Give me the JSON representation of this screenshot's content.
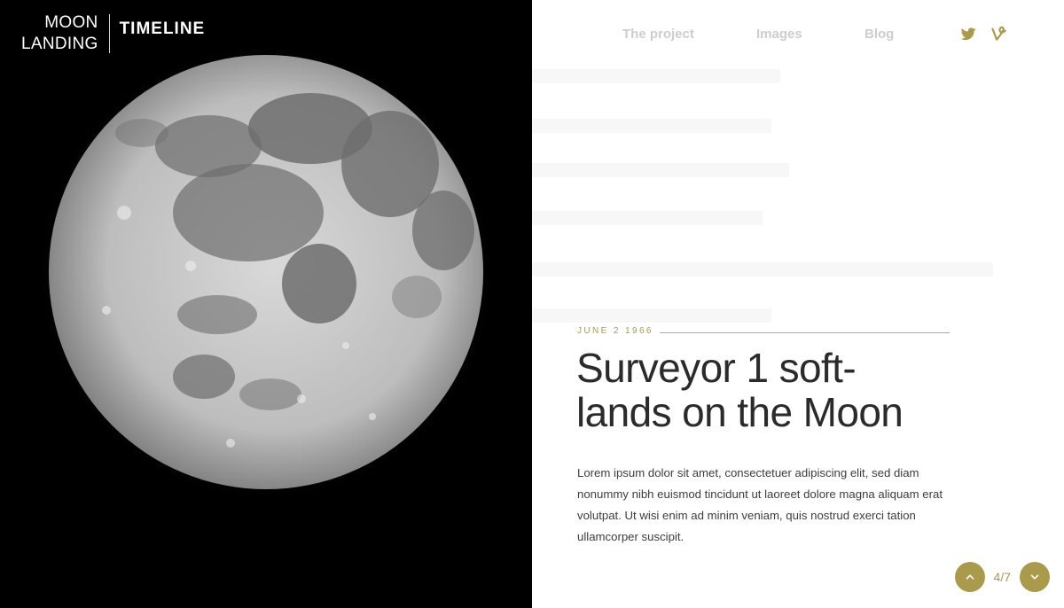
{
  "brand": {
    "line1": "MOON",
    "line2": "LANDING",
    "section": "TIMELINE"
  },
  "nav": {
    "items": [
      {
        "label": "The project"
      },
      {
        "label": "Images"
      },
      {
        "label": "Blog"
      }
    ],
    "social": [
      "twitter-icon",
      "vine-icon"
    ]
  },
  "event": {
    "date": "JUNE 2 1966",
    "title_line1": "Surveyor 1 soft-",
    "title_line2": "lands on the Moon",
    "body": "Lorem ipsum dolor sit amet, consectetuer adipiscing elit, sed diam nonummy nibh euismod tincidunt ut laoreet dolore magna aliquam erat volutpat. Ut wisi enim ad minim veniam, quis nostrud exerci tation ullamcorper suscipit."
  },
  "pager": {
    "counter": "4/7"
  },
  "colors": {
    "accent": "#a99a4c",
    "nav_text": "#cdcdcd",
    "left_background": "#000000",
    "right_background": "#ffffff"
  }
}
